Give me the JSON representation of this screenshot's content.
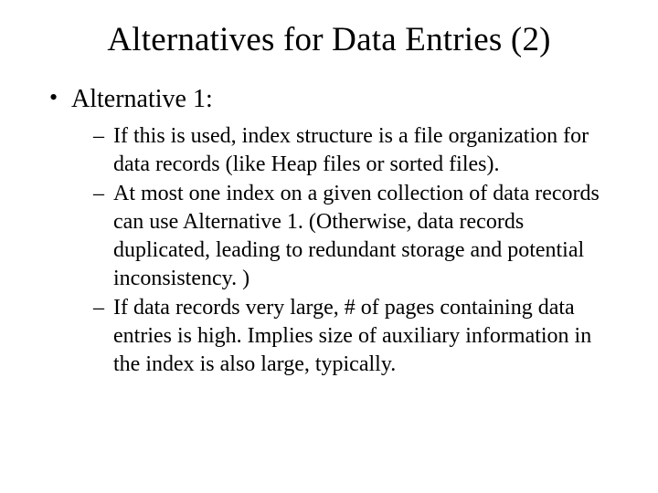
{
  "title": "Alternatives for Data Entries (2)",
  "bullet": {
    "label": "Alternative 1:",
    "items": [
      "If this is used, index structure is a file organization for data records (like Heap files or sorted files).",
      "At most one index on a given collection of data records can use Alternative 1.  (Otherwise, data records duplicated, leading to redundant storage and potential inconsistency. )",
      "If data records very large,  # of pages containing data entries is high.  Implies size of auxiliary information in the index is also large, typically."
    ]
  }
}
